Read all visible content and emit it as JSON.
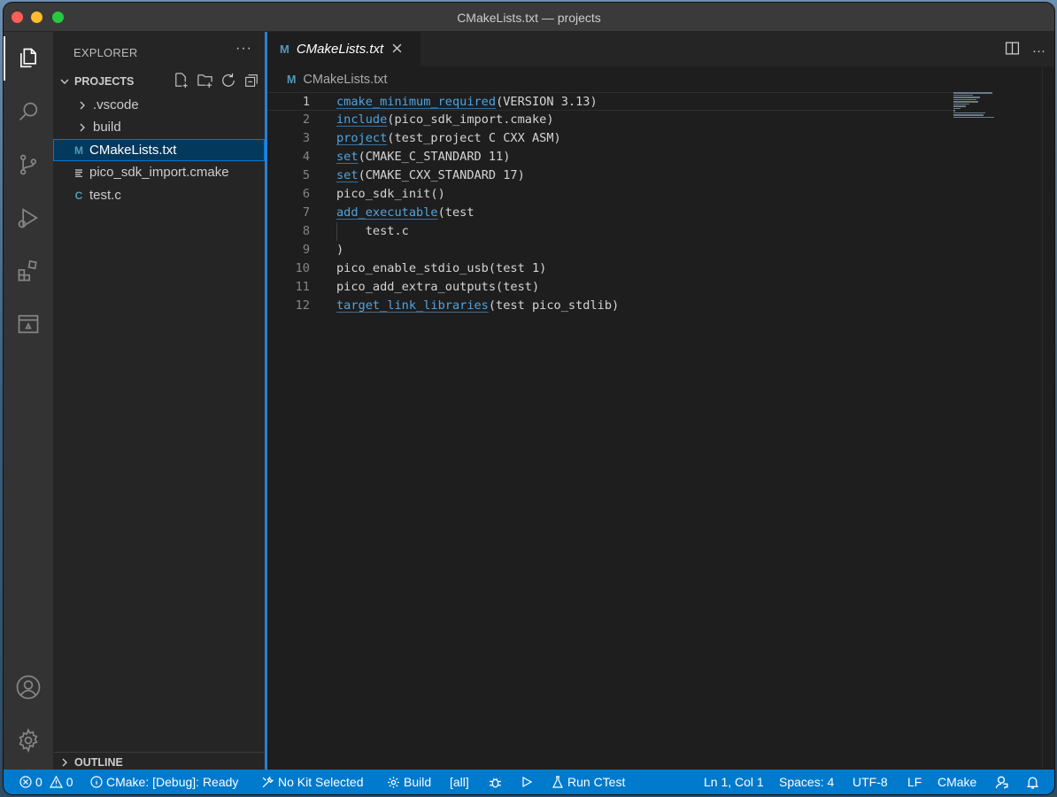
{
  "window": {
    "title": "CMakeLists.txt — projects"
  },
  "sidebar": {
    "title": "EXPLORER",
    "more": "···",
    "projects_header": "PROJECTS",
    "outline_header": "OUTLINE",
    "items": [
      {
        "label": ".vscode",
        "kind": "folder"
      },
      {
        "label": "build",
        "kind": "folder"
      },
      {
        "label": "CMakeLists.txt",
        "kind": "cmake",
        "icon_glyph": "M",
        "selected": true
      },
      {
        "label": "pico_sdk_import.cmake",
        "kind": "text"
      },
      {
        "label": "test.c",
        "kind": "c",
        "icon_glyph": "C"
      }
    ]
  },
  "editor": {
    "tab": {
      "label": "CMakeLists.txt",
      "icon_glyph": "M",
      "close": "×"
    },
    "breadcrumb": "CMakeLists.txt",
    "more": "···",
    "lines": [
      {
        "n": "1",
        "fn": "cmake_minimum_required",
        "rest": "(VERSION 3.13)"
      },
      {
        "n": "2",
        "fn": "include",
        "rest": "(pico_sdk_import.cmake)"
      },
      {
        "n": "3",
        "fn": "project",
        "rest": "(test_project C CXX ASM)"
      },
      {
        "n": "4",
        "fn": "set",
        "rest": "(CMAKE_C_STANDARD 11)"
      },
      {
        "n": "5",
        "fn": "set",
        "rest": "(CMAKE_CXX_STANDARD 17)"
      },
      {
        "n": "6",
        "fn": "",
        "rest": "pico_sdk_init()"
      },
      {
        "n": "7",
        "fn": "add_executable",
        "rest": "(test"
      },
      {
        "n": "8",
        "fn": "",
        "rest": "    test.c"
      },
      {
        "n": "9",
        "fn": "",
        "rest": ")"
      },
      {
        "n": "10",
        "fn": "",
        "rest": "pico_enable_stdio_usb(test 1)"
      },
      {
        "n": "11",
        "fn": "",
        "rest": "pico_add_extra_outputs(test)"
      },
      {
        "n": "12",
        "fn": "target_link_libraries",
        "rest": "(test pico_stdlib)"
      }
    ]
  },
  "statusbar": {
    "errors": "0",
    "warnings": "0",
    "cmake_status": "CMake: [Debug]: Ready",
    "kit": "No Kit Selected",
    "build": "Build",
    "target": "[all]",
    "run_ctest": "Run CTest",
    "position": "Ln 1, Col 1",
    "spaces": "Spaces: 4",
    "encoding": "UTF-8",
    "eol": "LF",
    "language": "CMake"
  },
  "colors": {
    "accent": "#007acc",
    "keyword": "#4fa4e0",
    "cmake_icon": "#519aba",
    "selection_outline": "#0078d4"
  }
}
